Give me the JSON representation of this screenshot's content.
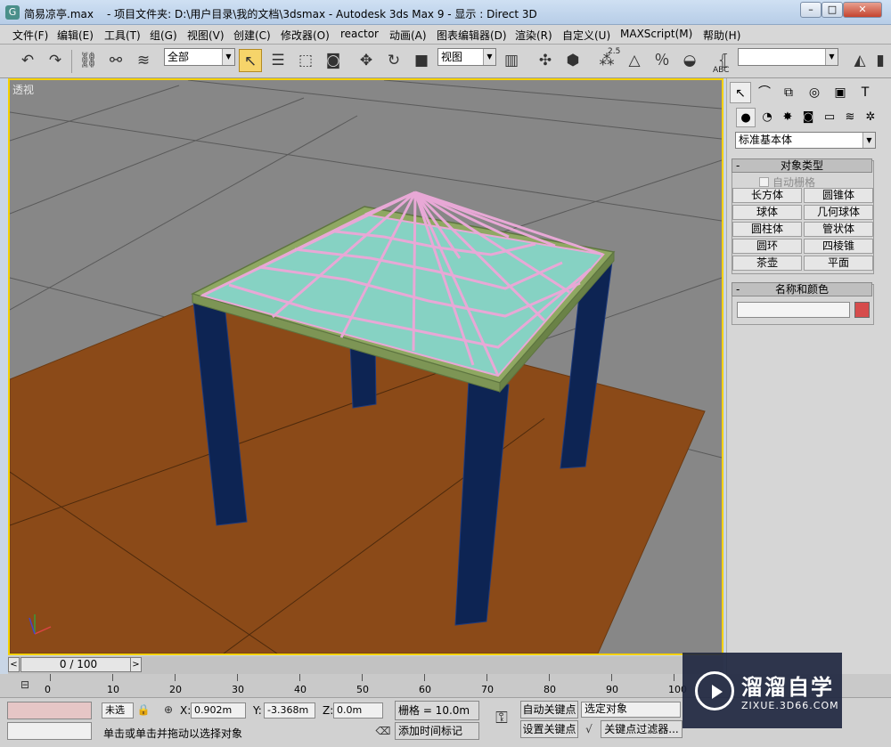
{
  "titlebar": {
    "file": "简易凉亭.max",
    "path": "- 项目文件夹: D:\\用户目录\\我的文档\\3dsmax    - Autodesk 3ds Max 9    - 显示 : Direct 3D",
    "minimize": "–",
    "maximize": "□",
    "close": "✕"
  },
  "menu": [
    "文件(F)",
    "编辑(E)",
    "工具(T)",
    "组(G)",
    "视图(V)",
    "创建(C)",
    "修改器(O)",
    "reactor",
    "动画(A)",
    "图表编辑器(D)",
    "渲染(R)",
    "自定义(U)",
    "MAXScript(M)",
    "帮助(H)"
  ],
  "toolbar": {
    "selection_filter": "全部",
    "ref_coord": "视图",
    "snap_angle_label": "2.5",
    "named_selection": "",
    "abc_label": "ABC"
  },
  "viewport": {
    "label": "透视",
    "colors": {
      "border": "#f5d100",
      "ground": "#8b4a18",
      "leg": "#0d2453",
      "frame": "#8fa862",
      "glass": "#86d2c3",
      "mullion": "#e8a8d6"
    }
  },
  "command_panel": {
    "category": "标准基本体",
    "object_type_title": "对象类型",
    "auto_grid": "自动栅格",
    "object_buttons": [
      "长方体",
      "圆锥体",
      "球体",
      "几何球体",
      "圆柱体",
      "管状体",
      "圆环",
      "四棱锥",
      "茶壶",
      "平面"
    ],
    "name_color_title": "名称和颜色",
    "object_name": "",
    "object_color": "#d64c4c",
    "rollout_minus": "-"
  },
  "time_slider": {
    "frame": "0 / 100",
    "prev": "<",
    "next": ">"
  },
  "track": {
    "ticks": [
      "0",
      "10",
      "20",
      "30",
      "40",
      "50",
      "60",
      "70",
      "80",
      "90",
      "100"
    ]
  },
  "status": {
    "selection_text": "未选",
    "prompt": "单击或单击并拖动以选择对象",
    "x_label": "X:",
    "x_value": "0.902m",
    "y_label": "Y:",
    "y_value": "-3.368m",
    "z_label": "Z:",
    "z_value": "0.0m",
    "grid": "栅格 = 10.0m",
    "add_time_tag": "添加时间标记",
    "auto_key": "自动关键点",
    "set_key": "设置关键点",
    "selected_objects": "选定对象",
    "key_filters": "关键点过滤器..."
  },
  "watermark": {
    "title": "溜溜自学",
    "url": "ZIXUE.3D66.COM"
  }
}
